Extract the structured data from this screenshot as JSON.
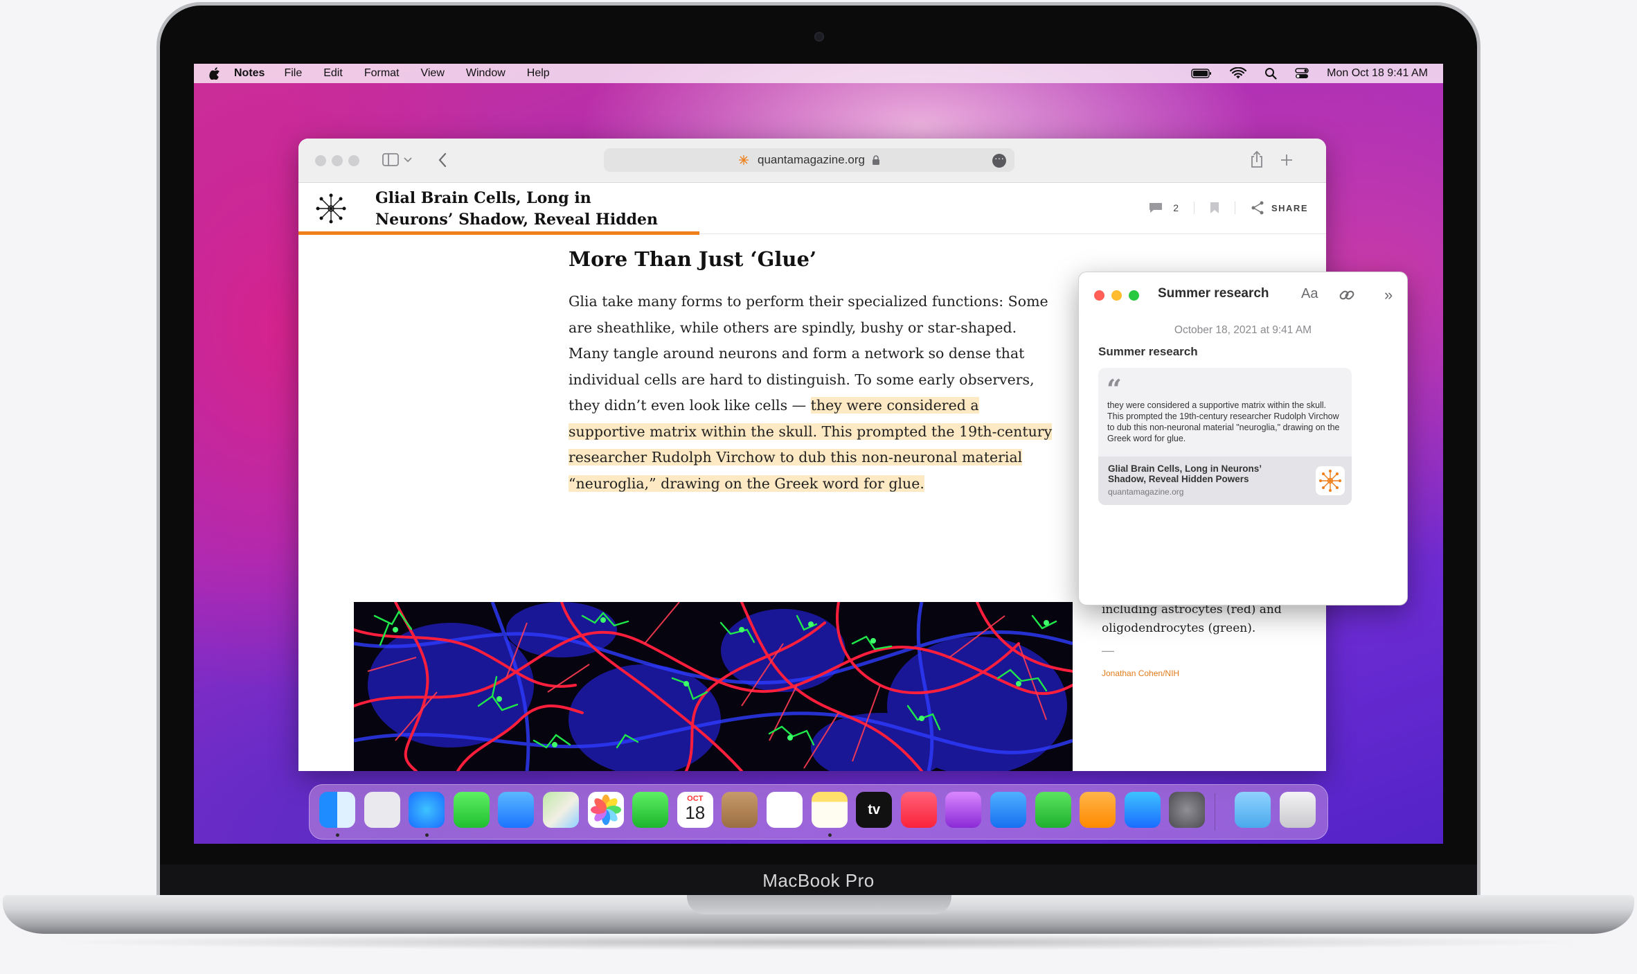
{
  "device": {
    "label": "MacBook Pro"
  },
  "menubar": {
    "app": "Notes",
    "items": [
      "File",
      "Edit",
      "Format",
      "View",
      "Window",
      "Help"
    ],
    "clock": "Mon Oct 18  9:41 AM"
  },
  "safari": {
    "url": "quantamagazine.org",
    "article_title": "Glial Brain Cells, Long in Neurons’ Shadow, Reveal Hidden Powers",
    "comment_count": "2",
    "share_label": "SHARE",
    "reading_progress": 0.39
  },
  "article": {
    "heading": "More Than Just ‘Glue’",
    "para_before": "Glia take many forms to perform their specialized functions: Some are sheathlike, while others are spindly, bushy or star-shaped. Many tangle around neurons and form a network so dense that individual cells are hard to distinguish. To some early observers, they didn’t even look like cells — ",
    "para_highlight": "they were considered a supportive matrix within the skull. This prompted the 19th-century researcher Rudolph Virchow to dub this non-neuronal material “neuroglia,” drawing on the Greek word for glue.",
    "caption": "including astrocytes (red) and oligodendrocytes (green).",
    "caption_dash": "—",
    "credit": "Jonathan Cohen/NIH"
  },
  "quick_note": {
    "title": "Summer research",
    "font_button": "Aa",
    "date": "October 18, 2021 at 9:41 AM",
    "heading": "Summer research",
    "quote": "they were considered a supportive matrix within the skull. This prompted the 19th-century researcher Rudolph Virchow to dub this non-neuronal material \"neuroglia,\" drawing on the Greek word for glue.",
    "link_title": "Glial Brain Cells, Long in Neurons’ Shadow, Reveal Hidden Powers",
    "link_url": "quantamagazine.org"
  },
  "dock": {
    "apps": [
      {
        "name": "Finder",
        "running": true
      },
      {
        "name": "Launchpad",
        "running": false
      },
      {
        "name": "Safari",
        "running": true
      },
      {
        "name": "Messages",
        "running": false
      },
      {
        "name": "Mail",
        "running": false
      },
      {
        "name": "Maps",
        "running": false
      },
      {
        "name": "Photos",
        "running": false
      },
      {
        "name": "FaceTime",
        "running": false
      },
      {
        "name": "Calendar",
        "running": false,
        "month": "OCT",
        "day": "18"
      },
      {
        "name": "Contacts",
        "running": false
      },
      {
        "name": "Reminders",
        "running": false
      },
      {
        "name": "Notes",
        "running": true
      },
      {
        "name": "TV",
        "running": false,
        "text": "tv"
      },
      {
        "name": "Music",
        "running": false
      },
      {
        "name": "Podcasts",
        "running": false
      },
      {
        "name": "Keynote",
        "running": false
      },
      {
        "name": "Numbers",
        "running": false
      },
      {
        "name": "Pages",
        "running": false
      },
      {
        "name": "App Store",
        "running": false
      },
      {
        "name": "System Preferences",
        "running": false
      },
      {
        "name": "Downloads",
        "running": false
      },
      {
        "name": "Trash",
        "running": false
      }
    ]
  },
  "colors": {
    "accent_orange": "#ef7f1a",
    "highlight": "#fde9c3"
  }
}
